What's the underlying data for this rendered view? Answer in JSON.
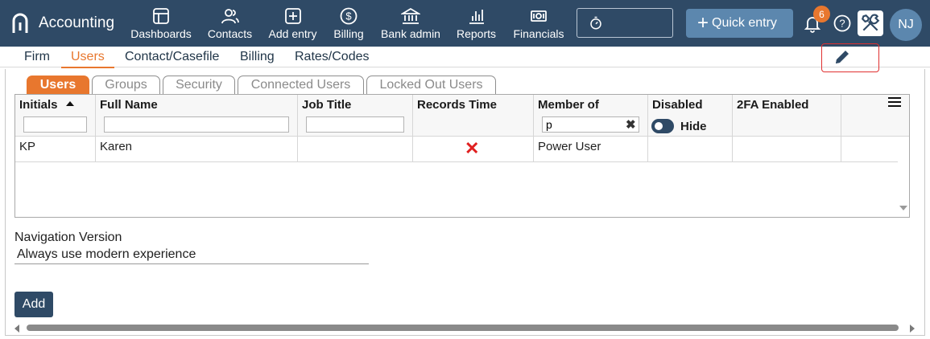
{
  "app": {
    "title": "Accounting",
    "logo_icon": "app-logo-icon"
  },
  "topnav": [
    {
      "label": "Dashboards",
      "icon": "dashboard-icon"
    },
    {
      "label": "Contacts",
      "icon": "contacts-icon"
    },
    {
      "label": "Add entry",
      "icon": "plus-square-icon"
    },
    {
      "label": "Billing",
      "icon": "dollar-circle-icon"
    },
    {
      "label": "Bank admin",
      "icon": "bank-icon"
    },
    {
      "label": "Reports",
      "icon": "bar-chart-icon"
    },
    {
      "label": "Financials",
      "icon": "banknote-icon"
    }
  ],
  "header": {
    "timer_icon": "stopwatch-icon",
    "quick_entry_label": "Quick entry",
    "notification_count": "6",
    "avatar_initials": "NJ"
  },
  "subnav": [
    "Firm",
    "Users",
    "Contact/Casefile",
    "Billing",
    "Rates/Codes"
  ],
  "subnav_active": "Users",
  "tabs": [
    "Users",
    "Groups",
    "Security",
    "Connected Users",
    "Locked Out Users"
  ],
  "tabs_active": "Users",
  "grid": {
    "columns": [
      "Initials",
      "Full Name",
      "Job Title",
      "Records Time",
      "Member of",
      "Disabled",
      "2FA Enabled"
    ],
    "sorted_column": "Initials",
    "sort_direction": "ascending",
    "filters": {
      "member_of": "p"
    },
    "disabled_toggle_label": "Hide",
    "rows": [
      {
        "initials": "KP",
        "full_name": "Karen",
        "job_title": "",
        "records_time": false,
        "member_of": "Power User",
        "disabled": "",
        "twofa_enabled": ""
      }
    ]
  },
  "navigation_version": {
    "label": "Navigation Version",
    "value": "Always use modern experience"
  },
  "add_button_label": "Add",
  "colors": {
    "header": "#2f4a66",
    "accent": "#e8772e",
    "quick_entry": "#5c87ae",
    "highlight": "#e03030"
  }
}
